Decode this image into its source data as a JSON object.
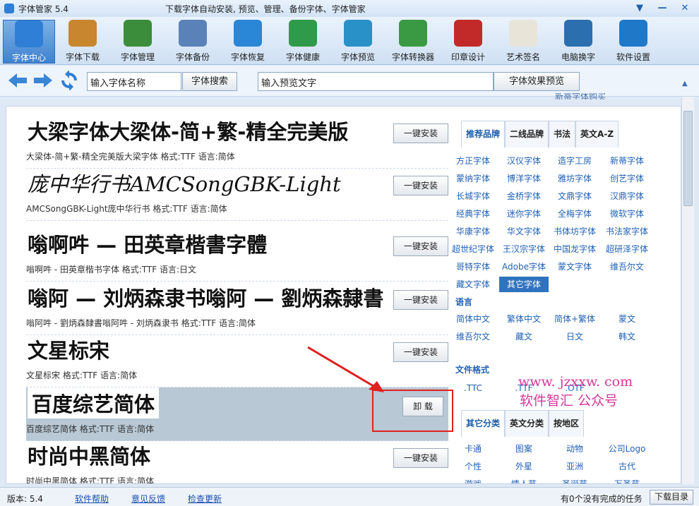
{
  "window": {
    "title": "字体管家 5.4",
    "subtitle": "下载字体自动安装, 预览、管理、备份字体、字体管家"
  },
  "toolbar": [
    {
      "name": "font-center",
      "label": "字体中心",
      "icon": "home-icon",
      "color": "#2f7fd6"
    },
    {
      "name": "font-download",
      "label": "字体下载",
      "icon": "download-box-icon",
      "color": "#c8862f"
    },
    {
      "name": "font-manage",
      "label": "字体管理",
      "icon": "font-manage-icon",
      "color": "#3b8d3b"
    },
    {
      "name": "font-backup",
      "label": "字体备份",
      "icon": "document-icon",
      "color": "#5b82b8"
    },
    {
      "name": "font-restore",
      "label": "字体恢复",
      "icon": "restore-icon",
      "color": "#2a86d6"
    },
    {
      "name": "font-health",
      "label": "字体健康",
      "icon": "medical-kit-icon",
      "color": "#2f9a4a"
    },
    {
      "name": "font-preview",
      "label": "字体预览",
      "icon": "magnifier-icon",
      "color": "#2a90c8"
    },
    {
      "name": "font-converter",
      "label": "字体转换器",
      "icon": "converter-icon",
      "color": "#3a9a44"
    },
    {
      "name": "seal-design",
      "label": "印章设计",
      "icon": "seal-icon",
      "color": "#c22a2a"
    },
    {
      "name": "art-signature",
      "label": "艺术签名",
      "icon": "signature-icon",
      "color": "#e8e4d8"
    },
    {
      "name": "pc-font-change",
      "label": "电脑换字",
      "icon": "monitor-icon",
      "color": "#2b6fae"
    },
    {
      "name": "settings",
      "label": "软件设置",
      "icon": "gear-icon",
      "color": "#1f78c8"
    }
  ],
  "nav": {
    "search_value": "输入字体名称",
    "search_button": "字体搜索",
    "preview_value": "输入预览文字",
    "preview_button": "字体效果预览",
    "hint": "新蒂字体购买"
  },
  "fonts": [
    {
      "preview": "大梁字体大梁体-简+繁-精全完美版",
      "meta": "大梁体-简+繁-精全完美版大梁字体 格式:TTF 语言:简体",
      "button": "一键安装",
      "style": "bold"
    },
    {
      "preview": "庞中华行书AMCSongGBK-Light",
      "meta": "AMCSongGBK-Light庞中华行书 格式:TTF 语言:简体",
      "button": "一键安装",
      "style": "italic"
    },
    {
      "preview": "嗡啊吽 — 田英章楷書字體",
      "meta": "嗡啊吽 - 田英章楷书字体 格式:TTF 语言:日文",
      "button": "一键安装",
      "style": "bold"
    },
    {
      "preview": "嗡阿  — 刘炳森隶书嗡阿  — 劉炳森隸書",
      "meta": "嗡阿吽 - 劉炳森隸書嗡阿吽 - 刘炳森隶书 格式:TTF 语言:简体",
      "button": "一键安装",
      "style": "bold"
    },
    {
      "preview": "文星标宋",
      "meta": "文星标宋 格式:TTF 语言:简体",
      "button": "一键安装",
      "style": "bold"
    },
    {
      "preview": "百度综艺简体",
      "meta": "百度综艺简体 格式:TTF 语言:简体",
      "button": "卸 载",
      "style": "bold",
      "selected": true
    },
    {
      "preview": "时尚中黑简体",
      "meta": "时尚中黑简体 格式:TTF 语言:简体",
      "button": "一键安装",
      "style": "bold"
    }
  ],
  "right_panel": {
    "tabs": [
      "推荐品牌",
      "二线品牌",
      "书法",
      "英文A-Z"
    ],
    "brands": [
      "方正字体",
      "汉仪字体",
      "造字工房",
      "新蒂字体",
      "蒙纳字体",
      "博洋字体",
      "雅坊字体",
      "创艺字体",
      "长城字体",
      "金桥字体",
      "文鼎字体",
      "汉鼎字体",
      "经典字体",
      "迷你字体",
      "全梅字体",
      "微软字体",
      "华康字体",
      "华文字体",
      "书体坊字体",
      "书法家字体",
      "超世纪字体",
      "王汉宗字体",
      "中国龙字体",
      "超研泽字体",
      "哥特字体",
      "Adobe字体",
      "蒙文字体",
      "维吾尔文",
      "藏文字体",
      "其它字体"
    ],
    "lang_title": "语言",
    "langs": [
      "简体中文",
      "繁体中文",
      "简体+繁体",
      "蒙文",
      "维吾尔文",
      "藏文",
      "日文",
      "韩文"
    ],
    "format_title": "文件格式",
    "formats": [
      ".TTC",
      ".TTF",
      ".OTF"
    ],
    "tabs2": [
      "其它分类",
      "英文分类",
      "按地区"
    ],
    "cats": [
      "卡通",
      "图案",
      "动物",
      "公司Logo",
      "个性",
      "外星",
      "亚洲",
      "古代",
      "游戏",
      "情人节",
      "圣诞节",
      "万圣节"
    ]
  },
  "watermark": {
    "url": "www. jzxxw. com",
    "text": "软件智汇  公众号"
  },
  "status": {
    "version": "版本: 5.4",
    "help": "软件帮助",
    "feedback": "意见反馈",
    "update": "检查更新",
    "tasks": "有0个没有完成的任务",
    "download_list": "下载目录"
  }
}
